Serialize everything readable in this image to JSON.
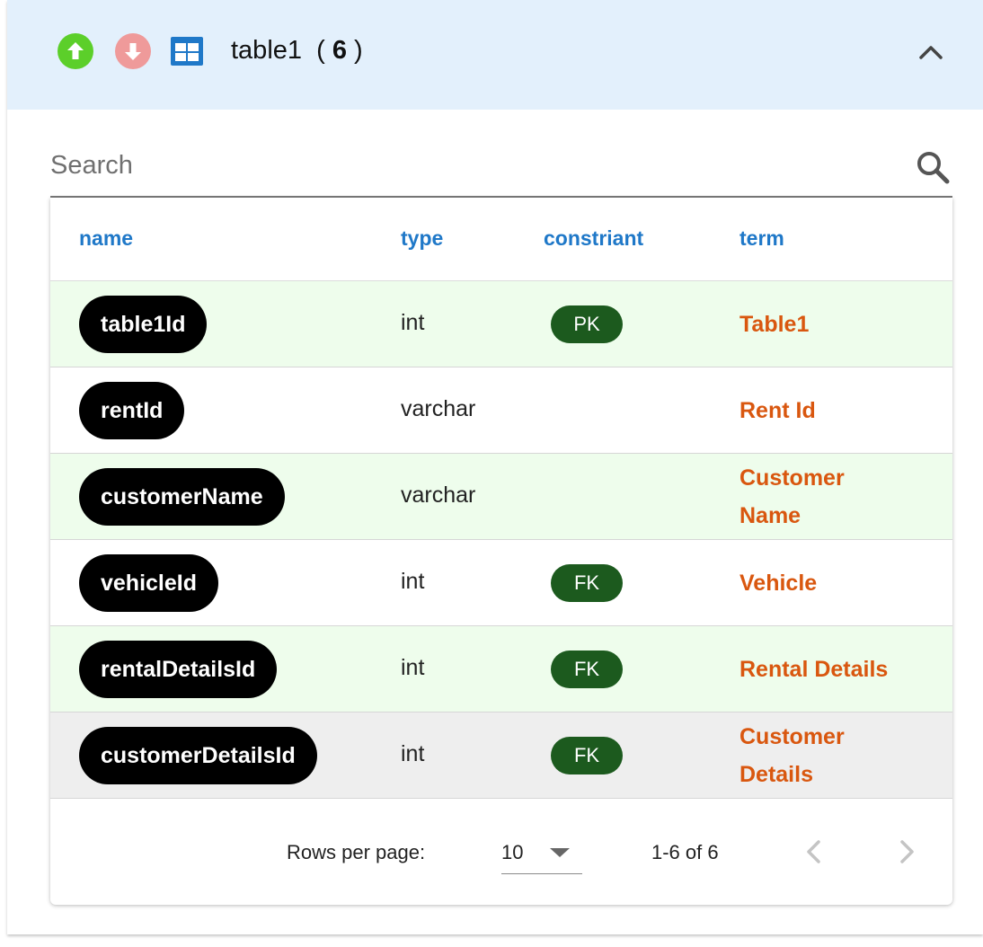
{
  "header": {
    "table_name": "table1",
    "column_count": "6",
    "icons": [
      "arrow-up-circle-icon",
      "arrow-down-circle-icon",
      "table-icon",
      "chevron-up-icon"
    ],
    "colors": {
      "header_bg": "#e3f0fc",
      "up_icon": "#5ccf2a",
      "down_icon": "#ef9a9a",
      "table_icon": "#1f78c8"
    }
  },
  "search": {
    "placeholder": "Search",
    "value": ""
  },
  "table": {
    "columns": [
      "name",
      "type",
      "constriant",
      "term"
    ],
    "rows": [
      {
        "name": "table1Id",
        "type": "int",
        "constraint": "PK",
        "term": [
          "Table1"
        ]
      },
      {
        "name": "rentId",
        "type": "varchar",
        "constraint": "",
        "term": [
          "Rent Id"
        ]
      },
      {
        "name": "customerName",
        "type": "varchar",
        "constraint": "",
        "term": [
          "Customer",
          "Name"
        ]
      },
      {
        "name": "vehicleId",
        "type": "int",
        "constraint": "FK",
        "term": [
          "Vehicle"
        ]
      },
      {
        "name": "rentalDetailsId",
        "type": "int",
        "constraint": "FK",
        "term": [
          "Rental Details"
        ]
      },
      {
        "name": "customerDetailsId",
        "type": "int",
        "constraint": "FK",
        "term": [
          "Customer",
          "Details"
        ]
      }
    ],
    "colors": {
      "header_text": "#1f78c8",
      "name_chip": "#000000",
      "constraint_chip": "#1c5a1e",
      "term_text": "#d9570f",
      "row_tint": "#eefdec",
      "row_hover": "#eeeeee"
    }
  },
  "pagination": {
    "rows_per_page_label": "Rows per page:",
    "rows_per_page": "10",
    "range": "1-6 of 6",
    "icons": [
      "chevron-left-icon",
      "chevron-right-icon"
    ]
  }
}
